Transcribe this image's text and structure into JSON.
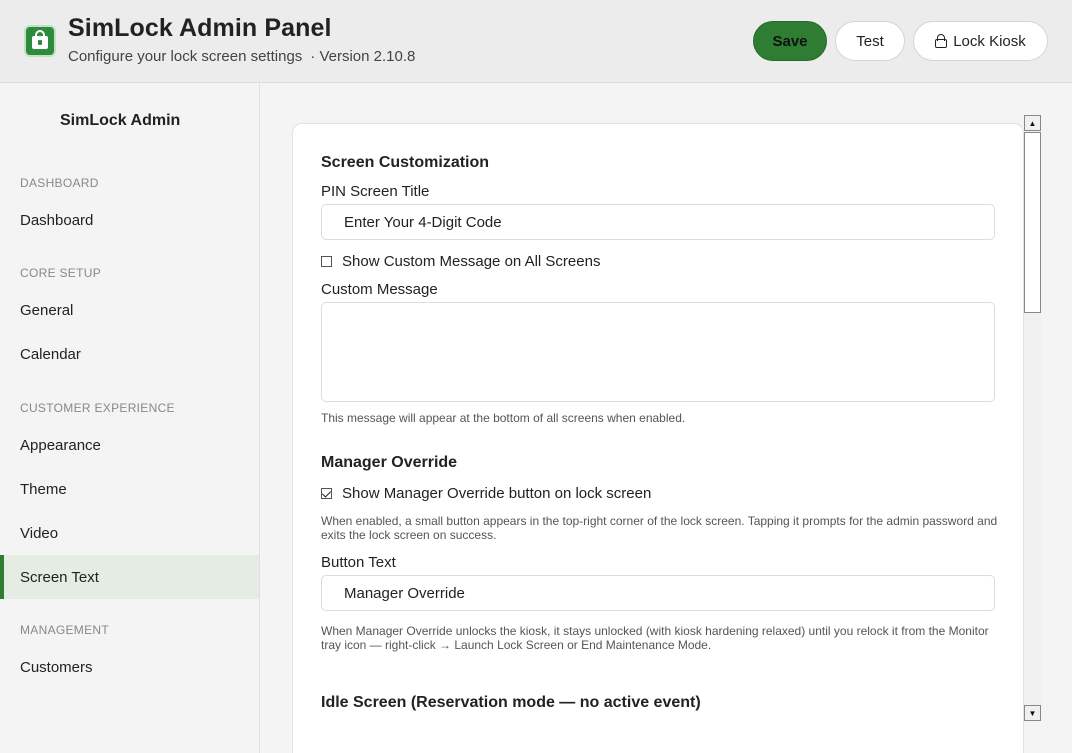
{
  "header": {
    "title": "SimLock Admin Panel",
    "subtitle": "Configure your lock screen settings",
    "version": "· Version 2.10.8",
    "buttons": {
      "save": "Save",
      "test": "Test",
      "lock": "Lock Kiosk"
    },
    "accent_color": "#2e7d32"
  },
  "sidebar": {
    "title": "SimLock Admin",
    "sections": {
      "dashboard": "DASHBOARD",
      "core": "CORE SETUP",
      "customer": "CUSTOMER EXPERIENCE",
      "management": "MANAGEMENT"
    },
    "items": {
      "dashboard": "Dashboard",
      "general": "General",
      "calendar": "Calendar",
      "appearance": "Appearance",
      "theme": "Theme",
      "video": "Video",
      "screen_text": "Screen Text",
      "customers": "Customers"
    },
    "active_item": "Screen Text"
  },
  "content": {
    "screen_customization": {
      "heading": "Screen Customization",
      "pin_title_label": "PIN Screen Title",
      "pin_title_value": "Enter Your 4-Digit Code",
      "show_custom_label": "Show Custom Message on All Screens",
      "show_custom_checked": false,
      "custom_message_label": "Custom Message",
      "custom_message_value": "",
      "custom_message_help": "This message will appear at the bottom of all screens when enabled."
    },
    "manager_override": {
      "heading": "Manager Override",
      "show_button_label": "Show Manager Override button on lock screen",
      "show_button_checked": true,
      "help1": "When enabled, a small button appears in the top-right corner of the lock screen. Tapping it prompts for the admin password and exits the lock screen on success.",
      "button_text_label": "Button Text",
      "button_text_value": "Manager Override",
      "help2": "When Manager Override unlocks the kiosk, it stays unlocked (with kiosk hardening relaxed) until you relock it from the Monitor tray icon — right-click → Launch Lock Screen or End Maintenance Mode."
    },
    "idle_screen": {
      "heading": "Idle Screen (Reservation mode — no active event)"
    }
  },
  "icons": {
    "logo": "lock-app-logo-icon",
    "lock": "lock-icon",
    "scroll_up": "scroll-up-arrow-icon",
    "scroll_down": "scroll-down-arrow-icon"
  }
}
